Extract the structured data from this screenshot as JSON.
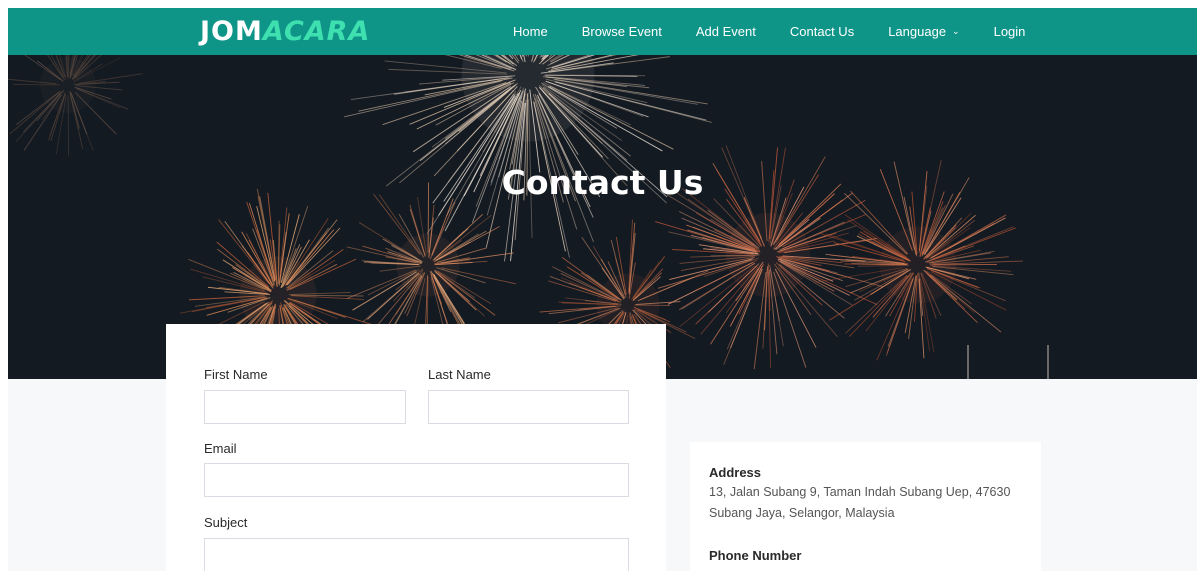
{
  "brand": {
    "part1": "JOM",
    "part2": "ACARA"
  },
  "nav": {
    "items": [
      "Home",
      "Browse Event",
      "Add Event",
      "Contact Us"
    ],
    "language": "Language",
    "login": "Login"
  },
  "hero": {
    "title": "Contact Us"
  },
  "form": {
    "first_name_label": "First Name",
    "last_name_label": "Last Name",
    "email_label": "Email",
    "subject_label": "Subject"
  },
  "info": {
    "address_heading": "Address",
    "address_text": "13, Jalan Subang 9, Taman Indah Subang Uep, 47630 Subang Jaya, Selangor, Malaysia",
    "phone_heading": "Phone Number"
  },
  "colors": {
    "nav": "#0f9488",
    "brand_accent": "#3ee0b0",
    "hero_bg": "#141a22",
    "section_bg": "#f6f8fa"
  }
}
